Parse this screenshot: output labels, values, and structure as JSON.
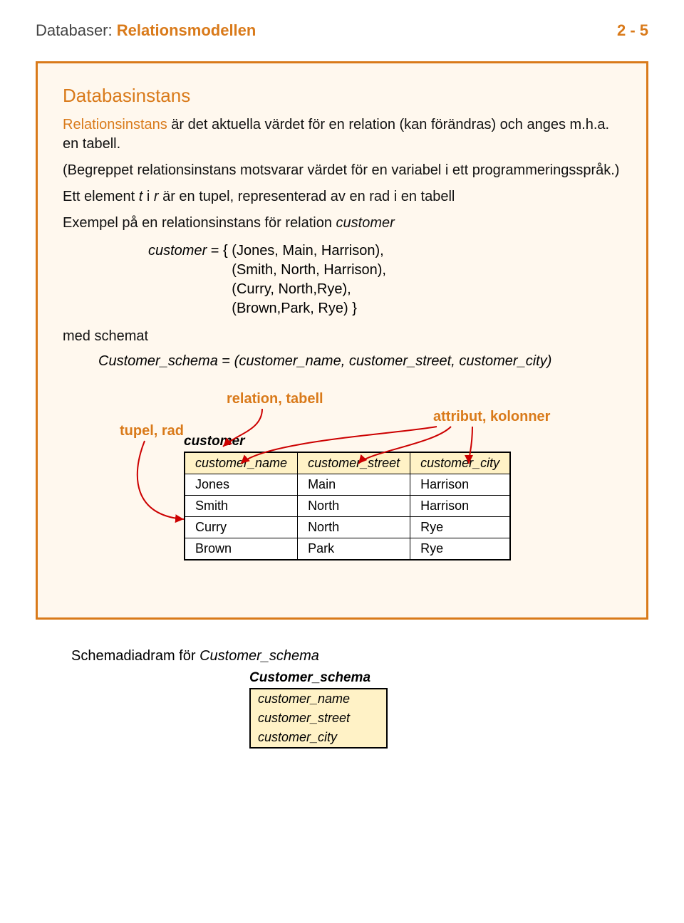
{
  "header": {
    "prefix": "Databaser:",
    "title": "Relationsmodellen",
    "page": "2 - 5"
  },
  "section_title": "Databasinstans",
  "para1_a": "Relationsinstans",
  "para1_b": " är det aktuella värdet för en relation (kan förändras) och anges m.h.a. en tabell.",
  "para2": "(Begreppet relationsinstans motsvarar värdet för en variabel i ett programmeringsspråk.)",
  "para3_a": "Ett element ",
  "para3_t": "t",
  "para3_b": " i ",
  "para3_r": "r",
  "para3_c": " är en tupel, representerad av en rad i en tabell",
  "para4_a": "Exempel på en relationsinstans för relation ",
  "para4_b": "customer",
  "set": {
    "label": "customer",
    "lines": [
      "(Jones, Main, Harrison),",
      "(Smith, North, Harrison),",
      "(Curry, North,Rye),",
      "(Brown,Park, Rye) }"
    ]
  },
  "med_schemat": "med schemat",
  "schema_line": {
    "lhs": "Customer_schema",
    "rhs": "customer_name, customer_street, customer_city"
  },
  "labels": {
    "relation": "relation, tabell",
    "attribut": "attribut, kolonner",
    "tupel": "tupel, rad"
  },
  "table": {
    "caption": "customer",
    "headers": [
      "customer_name",
      "customer_street",
      "customer_city"
    ],
    "rows": [
      [
        "Jones",
        "Main",
        "Harrison"
      ],
      [
        "Smith",
        "North",
        "Harrison"
      ],
      [
        "Curry",
        "North",
        "Rye"
      ],
      [
        "Brown",
        "Park",
        "Rye"
      ]
    ]
  },
  "schema_diag": {
    "intro": "Schemadiadram för ",
    "intro_i": "Customer_schema",
    "box_title": "Customer_schema",
    "attrs": [
      "customer_name",
      "customer_street",
      "customer_city"
    ]
  }
}
